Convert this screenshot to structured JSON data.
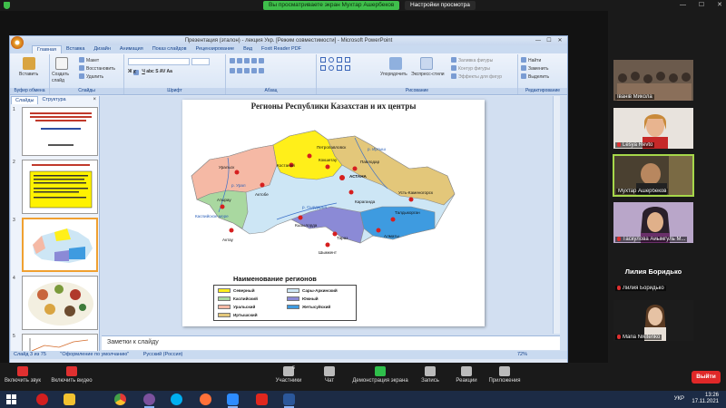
{
  "zoom": {
    "share_banner": "Вы просматриваете экран Мухтар Ашербеков",
    "view_options": "Настройки просмотра",
    "win_controls": [
      "—",
      "☐",
      "✕"
    ],
    "toolbar": [
      {
        "label": "Включить звук",
        "color": "#e03030"
      },
      {
        "label": "Включить видео",
        "color": "#e03030"
      },
      {
        "label": "Участники",
        "count": "6",
        "color": "#bbbbbb"
      },
      {
        "label": "Чат",
        "color": "#bbbbbb"
      },
      {
        "label": "Демонстрация экрана",
        "color": "#2fbf4b"
      },
      {
        "label": "Запись",
        "color": "#bbbbbb"
      },
      {
        "label": "Реакции",
        "color": "#bbbbbb"
      },
      {
        "label": "Приложения",
        "color": "#bbbbbb"
      }
    ],
    "leave": "Выйти"
  },
  "ppt": {
    "window_title": "Презентация (эталон) - лекция Укр. [Режим совместимости] - Microsoft PowerPoint",
    "tabs": [
      "Главная",
      "Вставка",
      "Дизайн",
      "Анимация",
      "Показ слайдов",
      "Рецензирование",
      "Вид",
      "Foxit Reader PDF"
    ],
    "groups": {
      "clipboard": "Буфер обмена",
      "slides": "Слайды",
      "font": "Шрифт",
      "paragraph": "Абзац",
      "drawing": "Рисование",
      "editing": "Редактирование"
    },
    "ribbon": {
      "paste": "Вставить",
      "create_slide": "Создать слайд",
      "layout": "Макет",
      "reset": "Восстановить",
      "delete": "Удалить",
      "arrange": "Упорядочить",
      "quick_styles": "Экспресс-стили",
      "fill": "Заливка фигуры",
      "outline": "Контур фигуры",
      "effects": "Эффекты для фигур",
      "find": "Найти",
      "replace": "Заменить",
      "select": "Выделить"
    },
    "panel_tabs": [
      "Слайды",
      "Структура"
    ],
    "slide_numbers": [
      "1",
      "2",
      "3",
      "4",
      "5"
    ],
    "slide": {
      "title": "Регионы Республики Казахстан и их центры",
      "legend_title": "Наименование регионов",
      "cities": [
        "Петропавловск",
        "Костанай",
        "Кокшетау",
        "Павлодар",
        "АСТАНА",
        "Уральск",
        "Актобе",
        "Караганда",
        "Усть-Каменогорск",
        "Атырау",
        "Каспийское море",
        "Актау",
        "Кызылорда",
        "Тараз",
        "Талдыкорган",
        "Алматы",
        "Шымкент",
        "р. Иртыш",
        "р. Урал",
        "р. Сырдарья"
      ],
      "legend": [
        {
          "label": "Северный",
          "color": "#ffef1a"
        },
        {
          "label": "Каспийский",
          "color": "#a9d8a0"
        },
        {
          "label": "Уральский",
          "color": "#f5b9a5"
        },
        {
          "label": "Иртышский",
          "color": "#e3c77a"
        },
        {
          "label": "Сары-Аркинский",
          "color": "#cde6f5"
        },
        {
          "label": "Южный",
          "color": "#8b8ad6"
        },
        {
          "label": "Жетысуйский",
          "color": "#3e9be0"
        }
      ]
    },
    "notes_placeholder": "Заметки к слайду",
    "status": {
      "slide": "Слайд 3 из 75",
      "theme": "\"Оформление по умолчанию\"",
      "language": "Русский (Россия)",
      "zoom": "72%"
    }
  },
  "participants": [
    {
      "name": "Іванів Микола",
      "muted": false
    },
    {
      "name": "Lesya Revto",
      "muted": true
    },
    {
      "name": "Мухтар Ашербеков",
      "muted": false,
      "active": true
    },
    {
      "name": "Таскулова Айымгуль М...",
      "muted": true
    },
    {
      "name": "Лилия Боридько",
      "muted": true,
      "big_name": "Лилия Боридько"
    },
    {
      "name": "Maria Nikitenko",
      "muted": true
    }
  ],
  "taskbar": {
    "apps": [
      "windows-start",
      "opera",
      "file-explorer",
      "chrome",
      "viber",
      "skype",
      "firefox",
      "zoom",
      "acrobat",
      "word"
    ],
    "language": "УКР",
    "time": "13:26",
    "date": "17.11.2021"
  }
}
